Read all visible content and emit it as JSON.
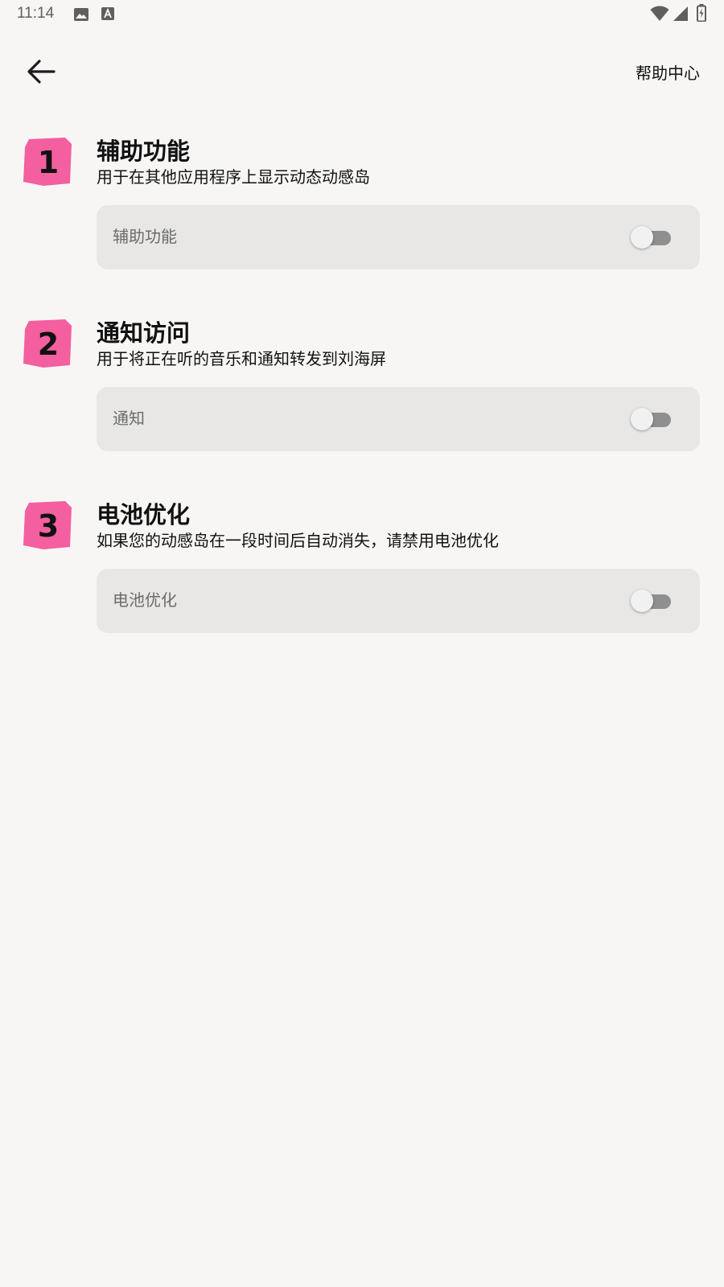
{
  "status_bar": {
    "time": "11:14",
    "left_icons": [
      "image-icon",
      "font-a-icon"
    ],
    "right_icons": [
      "wifi-icon",
      "cell-signal-icon",
      "battery-charging-icon"
    ]
  },
  "header": {
    "back_icon": "arrow-left-icon",
    "help_label": "帮助中心"
  },
  "colors": {
    "badge": "#f35f9f",
    "background": "#f7f6f5",
    "card": "#e8e7e6",
    "switch_track_off": "#8f8f8f"
  },
  "sections": [
    {
      "number": "1",
      "title": "辅助功能",
      "description": "用于在其他应用程序上显示动态动感岛",
      "card_label": "辅助功能",
      "enabled": false
    },
    {
      "number": "2",
      "title": "通知访问",
      "description": "用于将正在听的音乐和通知转发到刘海屏",
      "card_label": "通知",
      "enabled": false
    },
    {
      "number": "3",
      "title": "电池优化",
      "description": "如果您的动感岛在一段时间后自动消失，请禁用电池优化",
      "card_label": "电池优化",
      "enabled": false
    }
  ]
}
